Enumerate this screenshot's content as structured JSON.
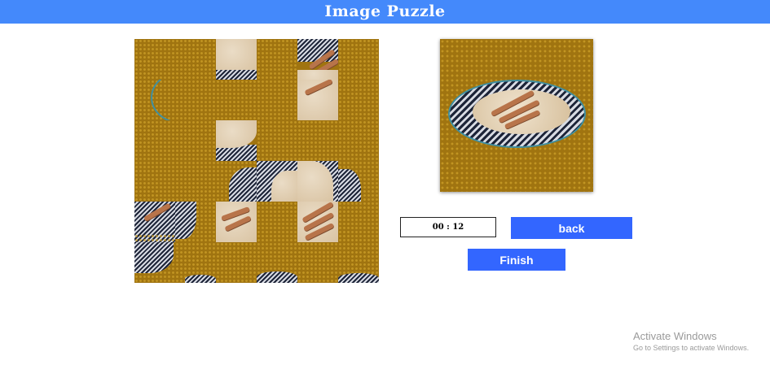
{
  "header": {
    "title": "Image Puzzle",
    "color": "#4489fb"
  },
  "controls": {
    "timer": "00 : 12",
    "back_label": "back",
    "finish_label": "Finish",
    "button_color": "#3366ff"
  },
  "watermark": {
    "title": "Activate Windows",
    "subtitle": "Go to Settings to activate Windows."
  }
}
